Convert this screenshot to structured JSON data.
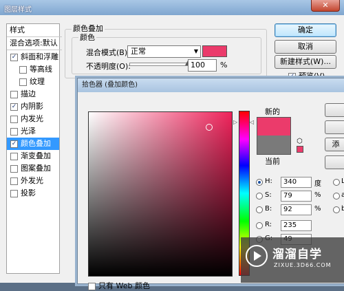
{
  "window": {
    "title": "图层样式",
    "close_glyph": "✕"
  },
  "styles_list": {
    "header": "样式",
    "blend_options": "混合选项:默认",
    "items": [
      {
        "label": "斜面和浮雕",
        "checked": true,
        "sub": false
      },
      {
        "label": "等高线",
        "checked": false,
        "sub": true
      },
      {
        "label": "纹理",
        "checked": false,
        "sub": true
      },
      {
        "label": "描边",
        "checked": false,
        "sub": false
      },
      {
        "label": "内阴影",
        "checked": true,
        "sub": false
      },
      {
        "label": "内发光",
        "checked": false,
        "sub": false
      },
      {
        "label": "光泽",
        "checked": false,
        "sub": false
      },
      {
        "label": "颜色叠加",
        "checked": true,
        "sub": false,
        "selected": true
      },
      {
        "label": "渐变叠加",
        "checked": false,
        "sub": false
      },
      {
        "label": "图案叠加",
        "checked": false,
        "sub": false
      },
      {
        "label": "外发光",
        "checked": false,
        "sub": false
      },
      {
        "label": "投影",
        "checked": false,
        "sub": false
      }
    ]
  },
  "color_overlay": {
    "section_title": "颜色叠加",
    "group_title": "颜色",
    "blend_mode_label": "混合模式(B):",
    "blend_mode_value": "正常",
    "opacity_label": "不透明度(O):",
    "opacity_value": "100",
    "opacity_unit": "%",
    "opacity_fraction": 1.0,
    "color": "#eb3b6b"
  },
  "buttons": {
    "ok": "确定",
    "cancel": "取消",
    "new_style": "新建样式(W)...",
    "preview": "预览(V)"
  },
  "picker": {
    "title": "拾色器 (叠加颜色)",
    "new_label": "新的",
    "current_label": "当前",
    "new_color": "#eb3b6b",
    "current_color": "#7a7a7a",
    "web_only_label": "只有 Web 颜色",
    "fields": {
      "H": {
        "label": "H:",
        "value": "340",
        "unit": "度"
      },
      "S": {
        "label": "S:",
        "value": "79",
        "unit": "%"
      },
      "B": {
        "label": "B:",
        "value": "92",
        "unit": "%"
      },
      "R": {
        "label": "R:",
        "value": "235"
      },
      "G": {
        "label": "G:",
        "value": "49"
      }
    },
    "right_labels": {
      "L": "L",
      "a": "a",
      "b": "b"
    },
    "right_button_partial": "添"
  },
  "watermark": {
    "brand": "溜溜自学",
    "url": "ZIXUE.3D66.COM"
  }
}
